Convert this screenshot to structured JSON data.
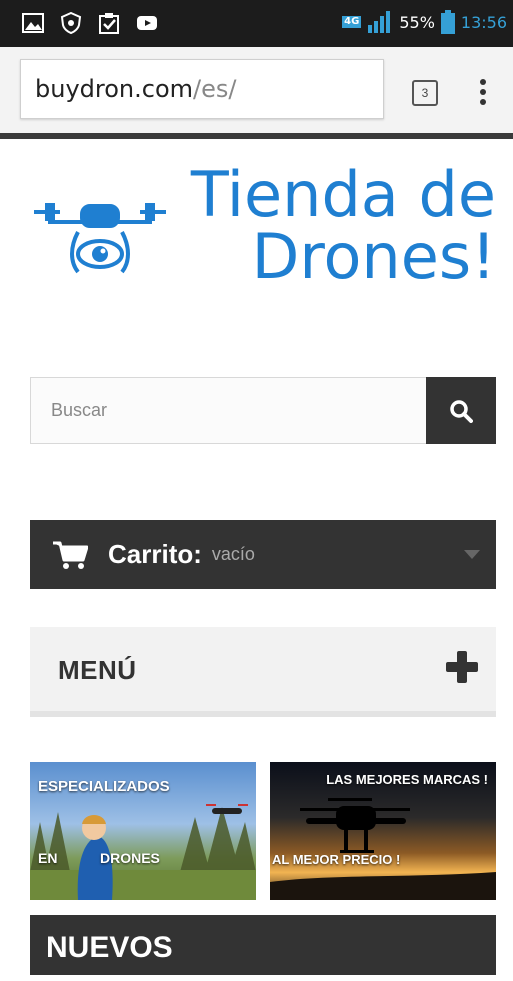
{
  "status_bar": {
    "network": "4G",
    "battery": "55%",
    "time": "13:56",
    "icons": [
      "image-icon",
      "shield-icon",
      "clipboard-check-icon",
      "youtube-icon",
      "signal-icon",
      "battery-icon"
    ]
  },
  "browser": {
    "url_host": "buydron.com",
    "url_path": "/es/",
    "tabs_count": "3"
  },
  "logo": {
    "line1": "Tienda de",
    "line2": "Drones!"
  },
  "search": {
    "placeholder": "Buscar"
  },
  "cart": {
    "label": "Carrito:",
    "status": "vacío"
  },
  "menu": {
    "label": "MENÚ"
  },
  "banners": {
    "left": {
      "line1": "ESPECIALIZADOS",
      "line2a": "EN",
      "line2b": "DRONES"
    },
    "right": {
      "line1": "LAS MEJORES MARCAS !",
      "line2": "AL MEJOR PRECIO !"
    }
  },
  "section": {
    "title": "NUEVOS"
  },
  "colors": {
    "brand_blue": "#1f7fd1",
    "dark_bar": "#333333",
    "status_accent": "#35a0d6"
  }
}
